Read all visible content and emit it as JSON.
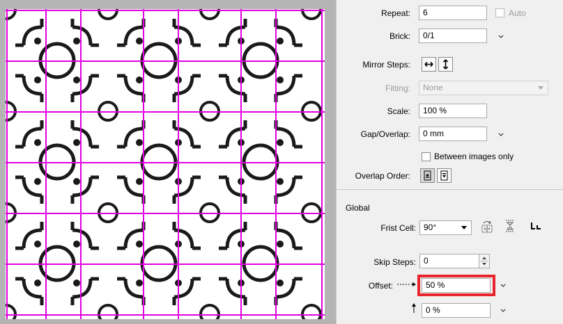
{
  "panel": {
    "repeat": {
      "label": "Repeat:",
      "value": "6",
      "auto_label": "Auto",
      "auto_checked": false
    },
    "brick": {
      "label": "Brick:",
      "value": "0/1"
    },
    "mirror_steps": {
      "label": "Mirror Steps:",
      "horizontal_icon": "arrow-left-right-icon",
      "vertical_icon": "arrow-up-down-icon"
    },
    "fitting": {
      "label": "Fitting:",
      "value": "None"
    },
    "scale": {
      "label": "Scale:",
      "value": "100 %"
    },
    "gap_overlap": {
      "label": "Gap/Overlap:",
      "value": "0 mm"
    },
    "between_images": {
      "label": "Between images only",
      "checked": false
    },
    "overlap_order": {
      "label": "Overlap Order:"
    },
    "global": {
      "heading": "Global",
      "first_cell": {
        "label": "Frist Cell:",
        "value": "90°"
      },
      "skip_steps": {
        "label": "Skip Steps:",
        "value": "0"
      },
      "offset": {
        "label": "Offset:",
        "value": "50 %"
      },
      "offset_vertical": {
        "value": "0 %"
      }
    }
  },
  "colors": {
    "grid": "#e000e0",
    "highlight": "#e8242c",
    "pattern": "#1a1a1a"
  }
}
